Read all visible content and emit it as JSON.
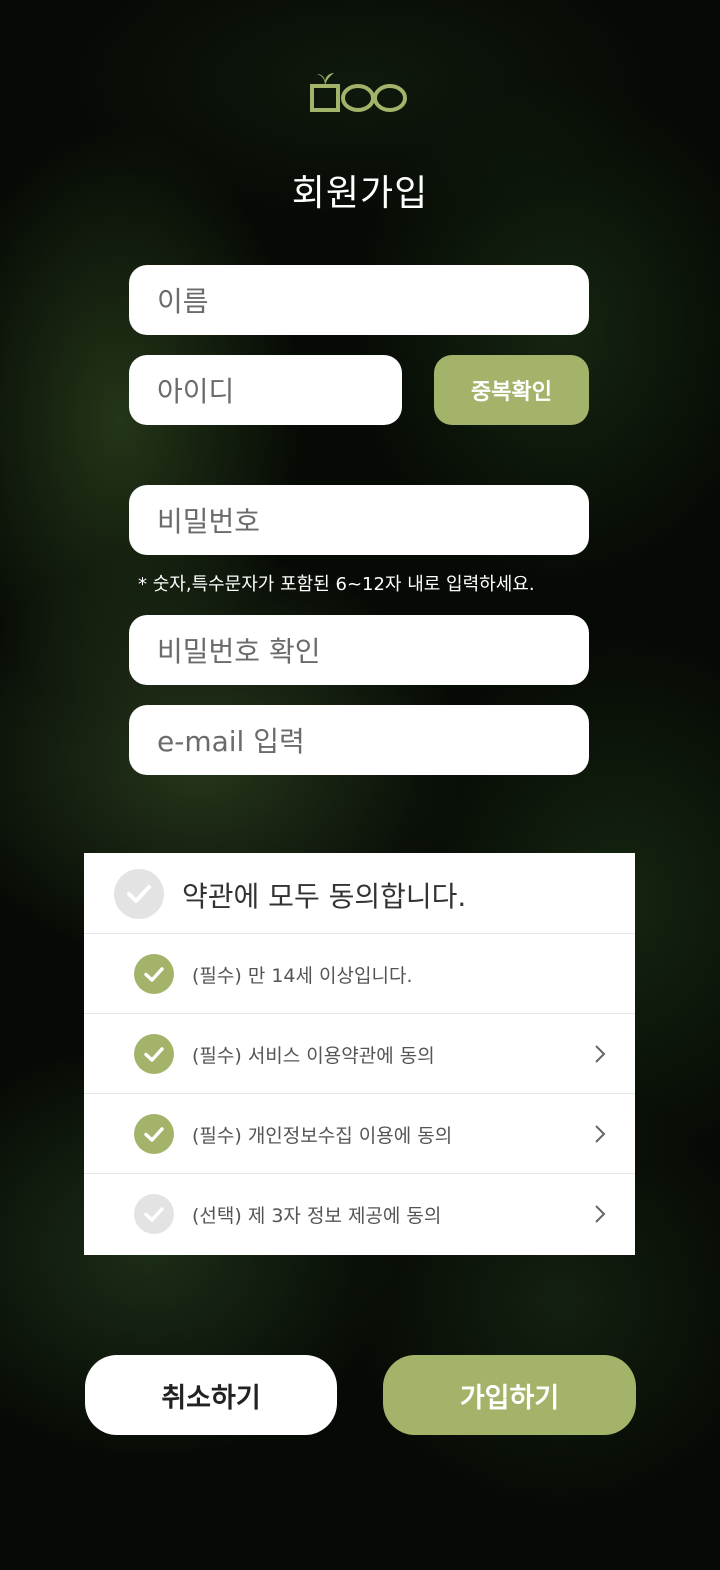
{
  "header": {
    "logo_icon": "sprout-box-logo-icon",
    "title": "회원가입"
  },
  "form": {
    "name_placeholder": "이름",
    "id_placeholder": "아이디",
    "duplicate_check_label": "중복확인",
    "password_placeholder": "비밀번호",
    "password_hint": "* 숫자,특수문자가 포함된 6~12자 내로 입력하세요.",
    "password_confirm_placeholder": "비밀번호 확인",
    "email_placeholder": "e-mail 입력"
  },
  "terms": {
    "agree_all_label": "약관에 모두 동의합니다.",
    "agree_all_checked": false,
    "items": [
      {
        "label": "(필수) 만 14세 이상입니다.",
        "checked": true,
        "has_detail": false
      },
      {
        "label": "(필수) 서비스 이용약관에 동의",
        "checked": true,
        "has_detail": true
      },
      {
        "label": "(필수) 개인정보수집 이용에 동의",
        "checked": true,
        "has_detail": true
      },
      {
        "label": "(선택) 제 3자 정보 제공에 동의",
        "checked": false,
        "has_detail": true
      }
    ]
  },
  "actions": {
    "cancel_label": "취소하기",
    "join_label": "가입하기"
  },
  "colors": {
    "accent": "#a3b36a",
    "unchecked": "#e3e3e3",
    "background": "#060a05"
  }
}
